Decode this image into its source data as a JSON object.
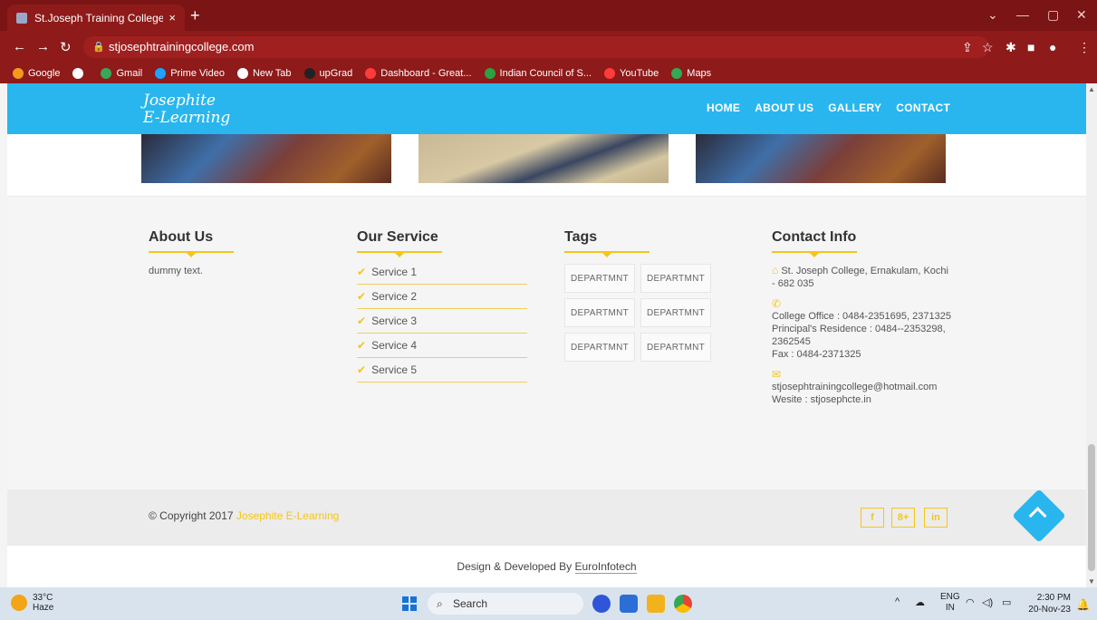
{
  "browser": {
    "tab_title": "St.Joseph Training College",
    "tab_close": "×",
    "new_tab": "+",
    "url": "stjosephtrainingcollege.com",
    "bookmarks": [
      {
        "label": "Google",
        "color": "#f29a1e"
      },
      {
        "label": "",
        "color": "#ffffff"
      },
      {
        "label": "Gmail",
        "color": "#3aa757"
      },
      {
        "label": "Prime Video",
        "color": "#1aa3ff"
      },
      {
        "label": "New Tab",
        "color": "#ffffff"
      },
      {
        "label": "upGrad",
        "color": "#222222"
      },
      {
        "label": "Dashboard - Great...",
        "color": "#ff3b3b"
      },
      {
        "label": "Indian Council of S...",
        "color": "#2ea043"
      },
      {
        "label": "YouTube",
        "color": "#ff3b3b"
      },
      {
        "label": "Maps",
        "color": "#34a853"
      }
    ]
  },
  "site": {
    "logo_line1": "Josephite",
    "logo_line2": "E-Learning",
    "menu": [
      "HOME",
      "ABOUT US",
      "GALLERY",
      "CONTACT"
    ]
  },
  "footer": {
    "about": {
      "title": "About Us",
      "text": "dummy text."
    },
    "services": {
      "title": "Our Service",
      "items": [
        "Service 1",
        "Service 2",
        "Service 3",
        "Service 4",
        "Service 5"
      ]
    },
    "tags": {
      "title": "Tags",
      "items": [
        "DEPARTMNT",
        "DEPARTMNT",
        "DEPARTMNT",
        "DEPARTMNT",
        "DEPARTMNT",
        "DEPARTMNT"
      ]
    },
    "contact": {
      "title": "Contact Info",
      "address": "St. Joseph College, Ernakulam, Kochi - 682 035",
      "phone_office": "College Office : 0484-2351695, 2371325",
      "phone_principal": "Principal's Residence : 0484--2353298, 2362545",
      "fax": "Fax : 0484-2371325",
      "email": "stjosephtrainingcollege@hotmail.com",
      "website": "Wesite : stjosephcte.in"
    },
    "copyright_prefix": "© Copyright 2017",
    "copyright_brand": "Josephite E-Learning",
    "social": [
      "f",
      "8+",
      "in"
    ],
    "credit_prefix": "Design & Developed By",
    "credit_link": "EuroInfotech"
  },
  "taskbar": {
    "temp": "33°C",
    "weather": "Haze",
    "search": "Search",
    "lang1": "ENG",
    "lang2": "IN",
    "time": "2:30 PM",
    "date": "20-Nov-23"
  },
  "colors": {
    "accent": "#29b6ee",
    "yellow": "#f5c518",
    "chrome": "#8e1a1a"
  }
}
